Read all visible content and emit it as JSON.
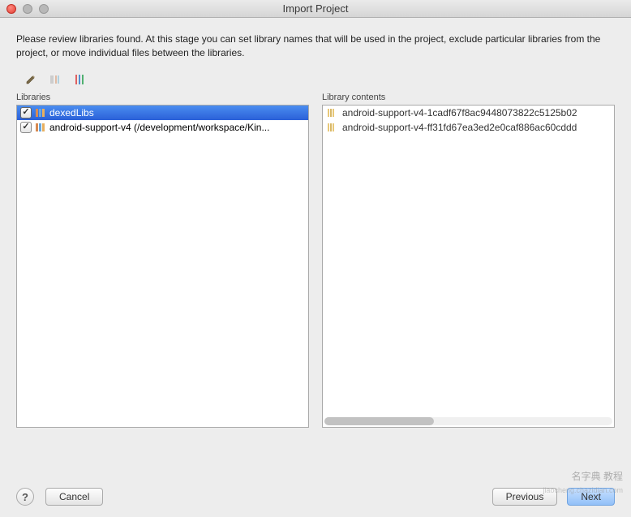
{
  "window": {
    "title": "Import Project"
  },
  "description": "Please review libraries found. At this stage you can set library names that will be used in the project, exclude particular libraries from the project, or move individual files between the libraries.",
  "labels": {
    "libraries": "Libraries",
    "library_contents": "Library contents"
  },
  "libraries": [
    {
      "name": "dexedLibs",
      "checked": true,
      "selected": true
    },
    {
      "name": "android-support-v4 (/development/workspace/Kin...",
      "checked": true,
      "selected": false
    }
  ],
  "library_contents": [
    {
      "name": "android-support-v4-1cadf67f8ac9448073822c5125b02"
    },
    {
      "name": "android-support-v4-ff31fd67ea3ed2e0caf886ac60cddd"
    }
  ],
  "buttons": {
    "help": "?",
    "cancel": "Cancel",
    "previous": "Previous",
    "next": "Next"
  },
  "watermark": {
    "main": "名字典 教程",
    "sub": "jiaocheng.chazidian.com"
  }
}
